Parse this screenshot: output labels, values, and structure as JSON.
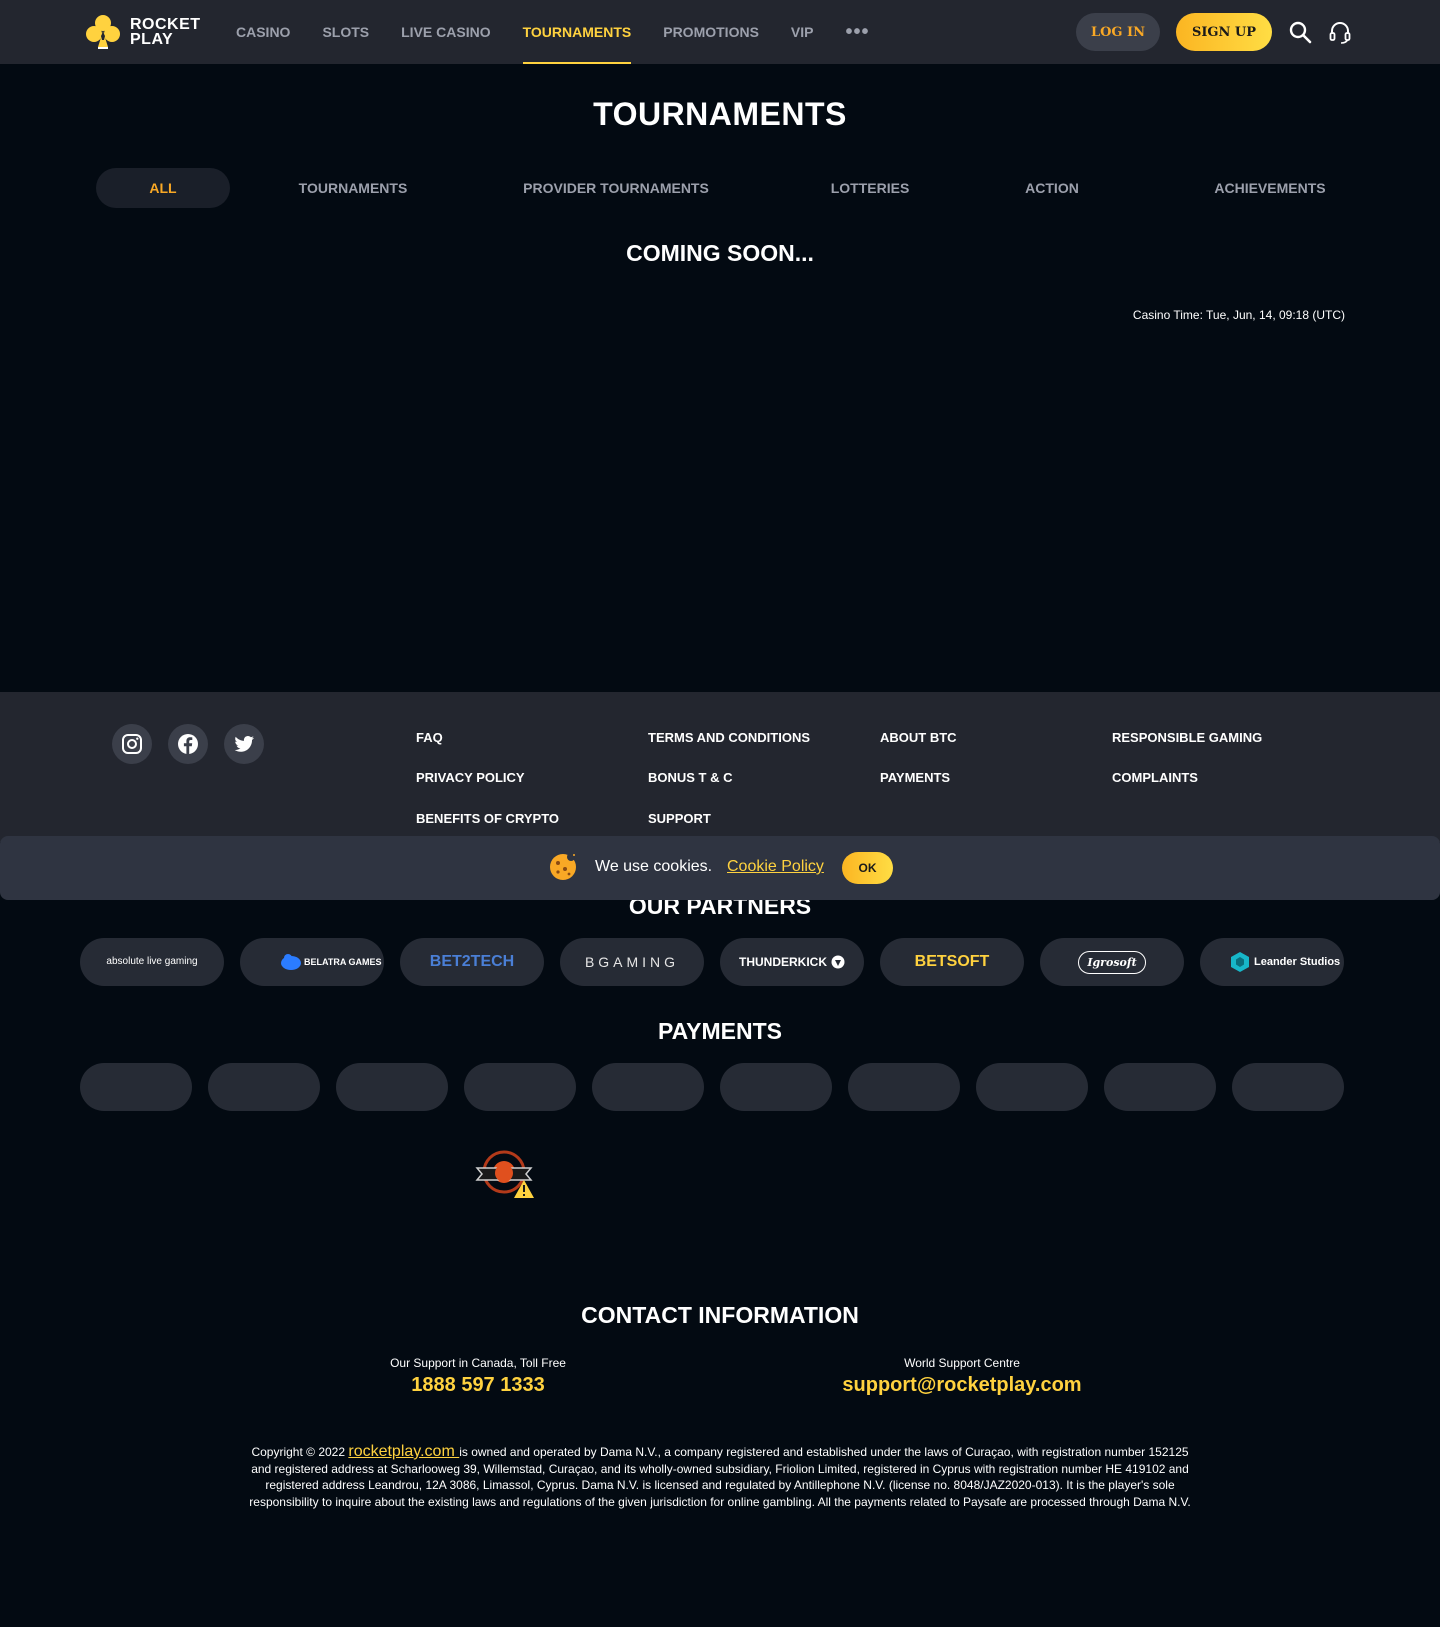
{
  "header": {
    "logo_line1": "ROCKET",
    "logo_line2": "PLAY",
    "nav": [
      "CASINO",
      "SLOTS",
      "LIVE CASINO",
      "TOURNAMENTS",
      "PROMOTIONS",
      "VIP"
    ],
    "nav_active": "TOURNAMENTS",
    "more": "•••",
    "login_label": "LOG IN",
    "signup_label": "SIGN UP"
  },
  "main": {
    "title": "TOURNAMENTS",
    "tabs": [
      "ALL",
      "TOURNAMENTS",
      "PROVIDER TOURNAMENTS",
      "LOTTERIES",
      "ACTION",
      "ACHIEVEMENTS"
    ],
    "active_tab": "ALL",
    "coming_soon": "COMING SOON...",
    "casino_time": "Casino Time: Tue, Jun, 14, 09:18 (UTC)"
  },
  "footer": {
    "social": [
      "instagram-icon",
      "facebook-icon",
      "twitter-icon"
    ],
    "links": {
      "col1": [
        "FAQ",
        "PRIVACY POLICY",
        "BENEFITS OF CRYPTO"
      ],
      "col2": [
        "TERMS AND CONDITIONS",
        "BONUS T & C",
        "SUPPORT"
      ],
      "col3": [
        "ABOUT BTC",
        "PAYMENTS"
      ],
      "col4": [
        "RESPONSIBLE GAMING",
        "COMPLAINTS"
      ]
    }
  },
  "cookie": {
    "text": "We use cookies.",
    "link": "Cookie Policy",
    "ok": "OK"
  },
  "partners": {
    "title": "OUR PARTNERS",
    "items": [
      "absolute live gaming",
      "BELATRA GAMES",
      "BET2TECH",
      "BGAMING",
      "THUNDERKICK",
      "BETSOFT",
      "Igrosoft",
      "Leander Studios"
    ]
  },
  "payments": {
    "title": "PAYMENTS",
    "count": 10
  },
  "contact": {
    "title": "CONTACT INFORMATION",
    "canada_label": "Our Support in Canada, Toll Free",
    "canada_phone": "1888 597 1333",
    "world_label": "World Support Centre",
    "world_email": "support@rocketplay.com"
  },
  "copyright": {
    "prefix": "Copyright © 2022 ",
    "link": "rocketplay.com ",
    "text": "is owned and operated by Dama N.V., a company registered and established under the laws of Curaçao, with registration number 152125 and registered address at Scharlooweg 39, Willemstad, Curaçao, and its wholly-owned subsidiary, Friolion Limited, registered in Cyprus with registration number HE 419102 and registered address Leandrou, 12A 3086, Limassol, Cyprus. Dama N.V. is licensed and regulated by Antillephone N.V. (license no. 8048/JAZ2020-013). It is the player's sole responsibility to inquire about the existing laws and regulations of the given jurisdiction for online gambling. All the payments related to Paysafe are processed through Dama N.V."
  },
  "colors": {
    "accent": "#ffd23f",
    "accent_orange": "#f9a825",
    "bg": "#030a12",
    "header_bg": "#23262f"
  }
}
